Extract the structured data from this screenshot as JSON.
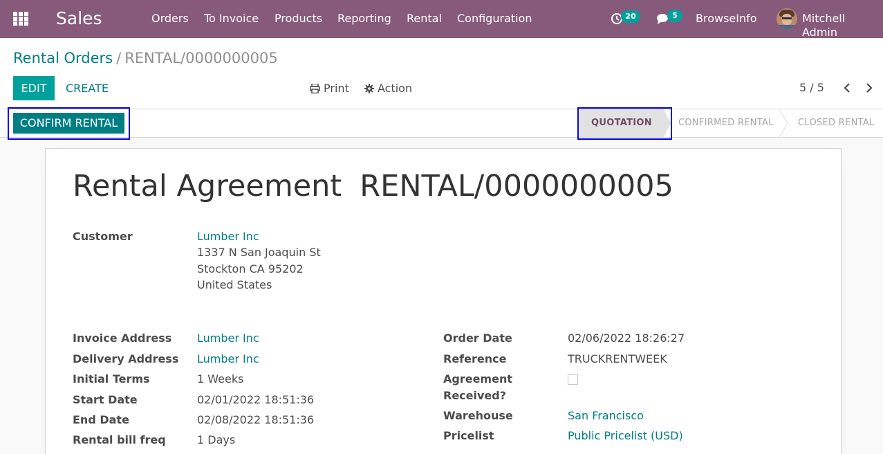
{
  "navbar": {
    "brand": "Sales",
    "menu": [
      "Orders",
      "To Invoice",
      "Products",
      "Reporting",
      "Rental",
      "Configuration"
    ],
    "activity_count": "20",
    "message_count": "5",
    "company": "BrowseInfo",
    "user": "Mitchell Admin"
  },
  "breadcrumb": {
    "parent": "Rental Orders",
    "separator": "/",
    "current": "RENTAL/0000000005"
  },
  "toolbar": {
    "edit_label": "EDIT",
    "create_label": "CREATE",
    "print_label": "Print",
    "action_label": "Action",
    "pager": "5 / 5"
  },
  "statusbar": {
    "confirm_label": "CONFIRM RENTAL",
    "stages": [
      "QUOTATION",
      "CONFIRMED RENTAL",
      "CLOSED RENTAL"
    ],
    "current_stage": "QUOTATION"
  },
  "form": {
    "title_prefix": "Rental Agreement",
    "title_ref": "RENTAL/0000000005",
    "customer": {
      "label": "Customer",
      "name": "Lumber Inc",
      "street": "1337 N San Joaquin St",
      "city": "Stockton CA 95202",
      "country": "United States"
    },
    "left": [
      {
        "label": "Invoice Address",
        "value": "Lumber Inc",
        "link": true
      },
      {
        "label": "Delivery Address",
        "value": "Lumber Inc",
        "link": true
      },
      {
        "label": "Initial Terms",
        "value": "1 Weeks",
        "link": false
      },
      {
        "label": "Start Date",
        "value": "02/01/2022 18:51:36",
        "link": false
      },
      {
        "label": "End Date",
        "value": "02/08/2022 18:51:36",
        "link": false
      },
      {
        "label": "Rental bill freq",
        "value": "1 Days",
        "link": false
      }
    ],
    "right": {
      "order_date_label": "Order Date",
      "order_date": "02/06/2022 18:26:27",
      "reference_label": "Reference",
      "reference": "TRUCKRENTWEEK",
      "agreement_label_1": "Agreement",
      "agreement_label_2": "Received?",
      "agreement_received": false,
      "warehouse_label": "Warehouse",
      "warehouse": "San Francisco",
      "pricelist_label": "Pricelist",
      "pricelist": "Public Pricelist (USD)"
    }
  },
  "colors": {
    "navbar": "#875a7b",
    "primary": "#00a09d",
    "link": "#017e84",
    "highlight_box": "#0000e6"
  }
}
